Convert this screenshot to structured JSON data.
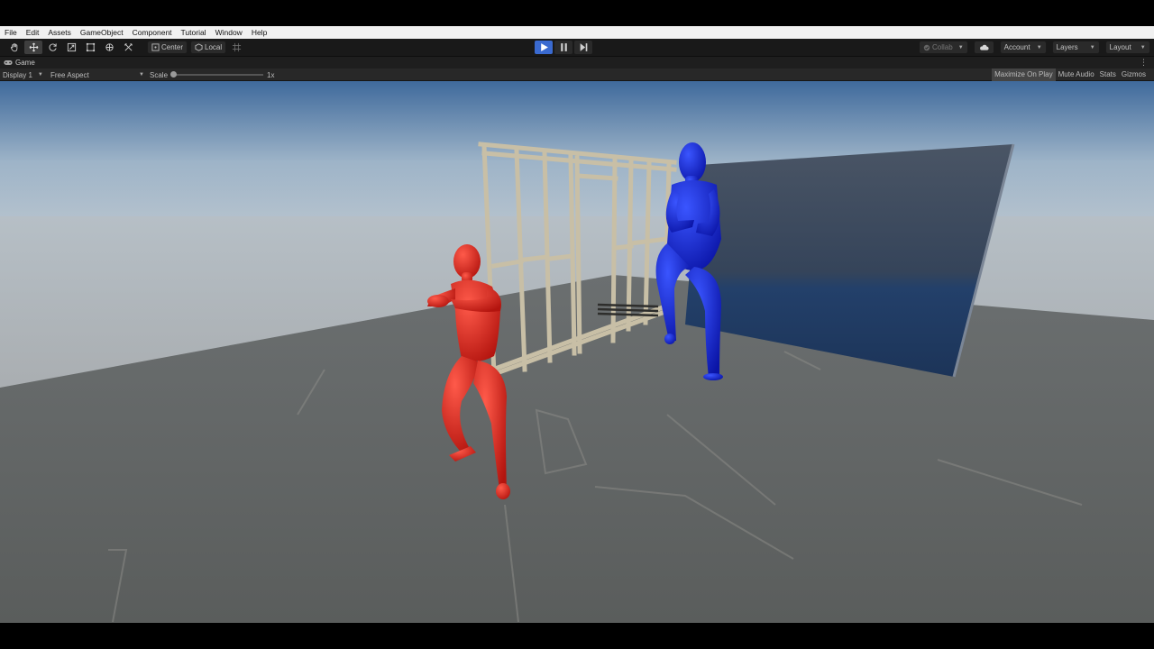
{
  "menu": [
    "File",
    "Edit",
    "Assets",
    "GameObject",
    "Component",
    "Tutorial",
    "Window",
    "Help"
  ],
  "toolbar": {
    "tools": [
      "hand-tool",
      "move-tool",
      "rotate-tool",
      "scale-tool",
      "rect-tool",
      "transform-tool",
      "custom-tool"
    ],
    "pivot_label": "Center",
    "space_label": "Local",
    "collab_label": "Collab",
    "account_label": "Account",
    "layers_label": "Layers",
    "layout_label": "Layout"
  },
  "game_tab": {
    "title": "Game"
  },
  "game_bar": {
    "display": "Display 1",
    "aspect": "Free Aspect",
    "scale_label": "Scale",
    "scale_value": "1x",
    "maximize_on_play": "Maximize On Play",
    "mute_audio": "Mute Audio",
    "stats": "Stats",
    "gizmos": "Gizmos"
  },
  "colors": {
    "accent_play": "#3a6ad0",
    "red_character": "#e0261e",
    "blue_character": "#1426d8"
  }
}
